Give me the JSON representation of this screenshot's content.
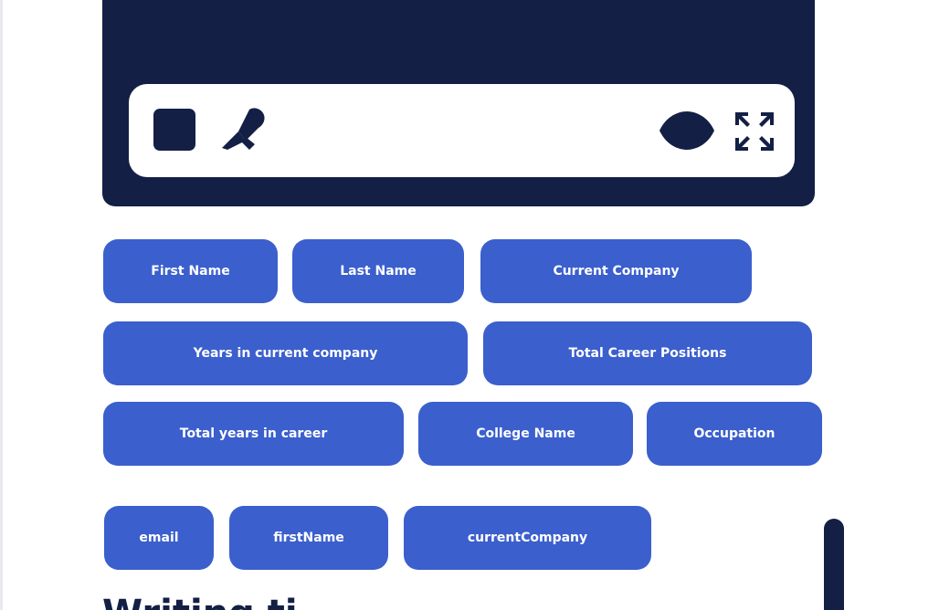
{
  "editor": {
    "toolbar": {
      "left_icons": [
        "stop-icon",
        "pen-icon"
      ],
      "right_icons": [
        "eye-icon",
        "expand-icon"
      ]
    },
    "colors": {
      "panel": "#131f45",
      "toolbar": "#ffffff"
    }
  },
  "variables": {
    "chip_color": "#3b5fcd",
    "chip_text_color": "#ffffff",
    "rows": [
      [
        "First Name",
        "Last Name",
        "Current Company"
      ],
      [
        "Years in current company",
        "Total Career Positions"
      ],
      [
        "Total years in career",
        "College Name",
        "Occupation"
      ],
      [
        "email",
        "firstName",
        "currentCompany"
      ]
    ]
  },
  "section": {
    "heading": "Writing ti"
  }
}
